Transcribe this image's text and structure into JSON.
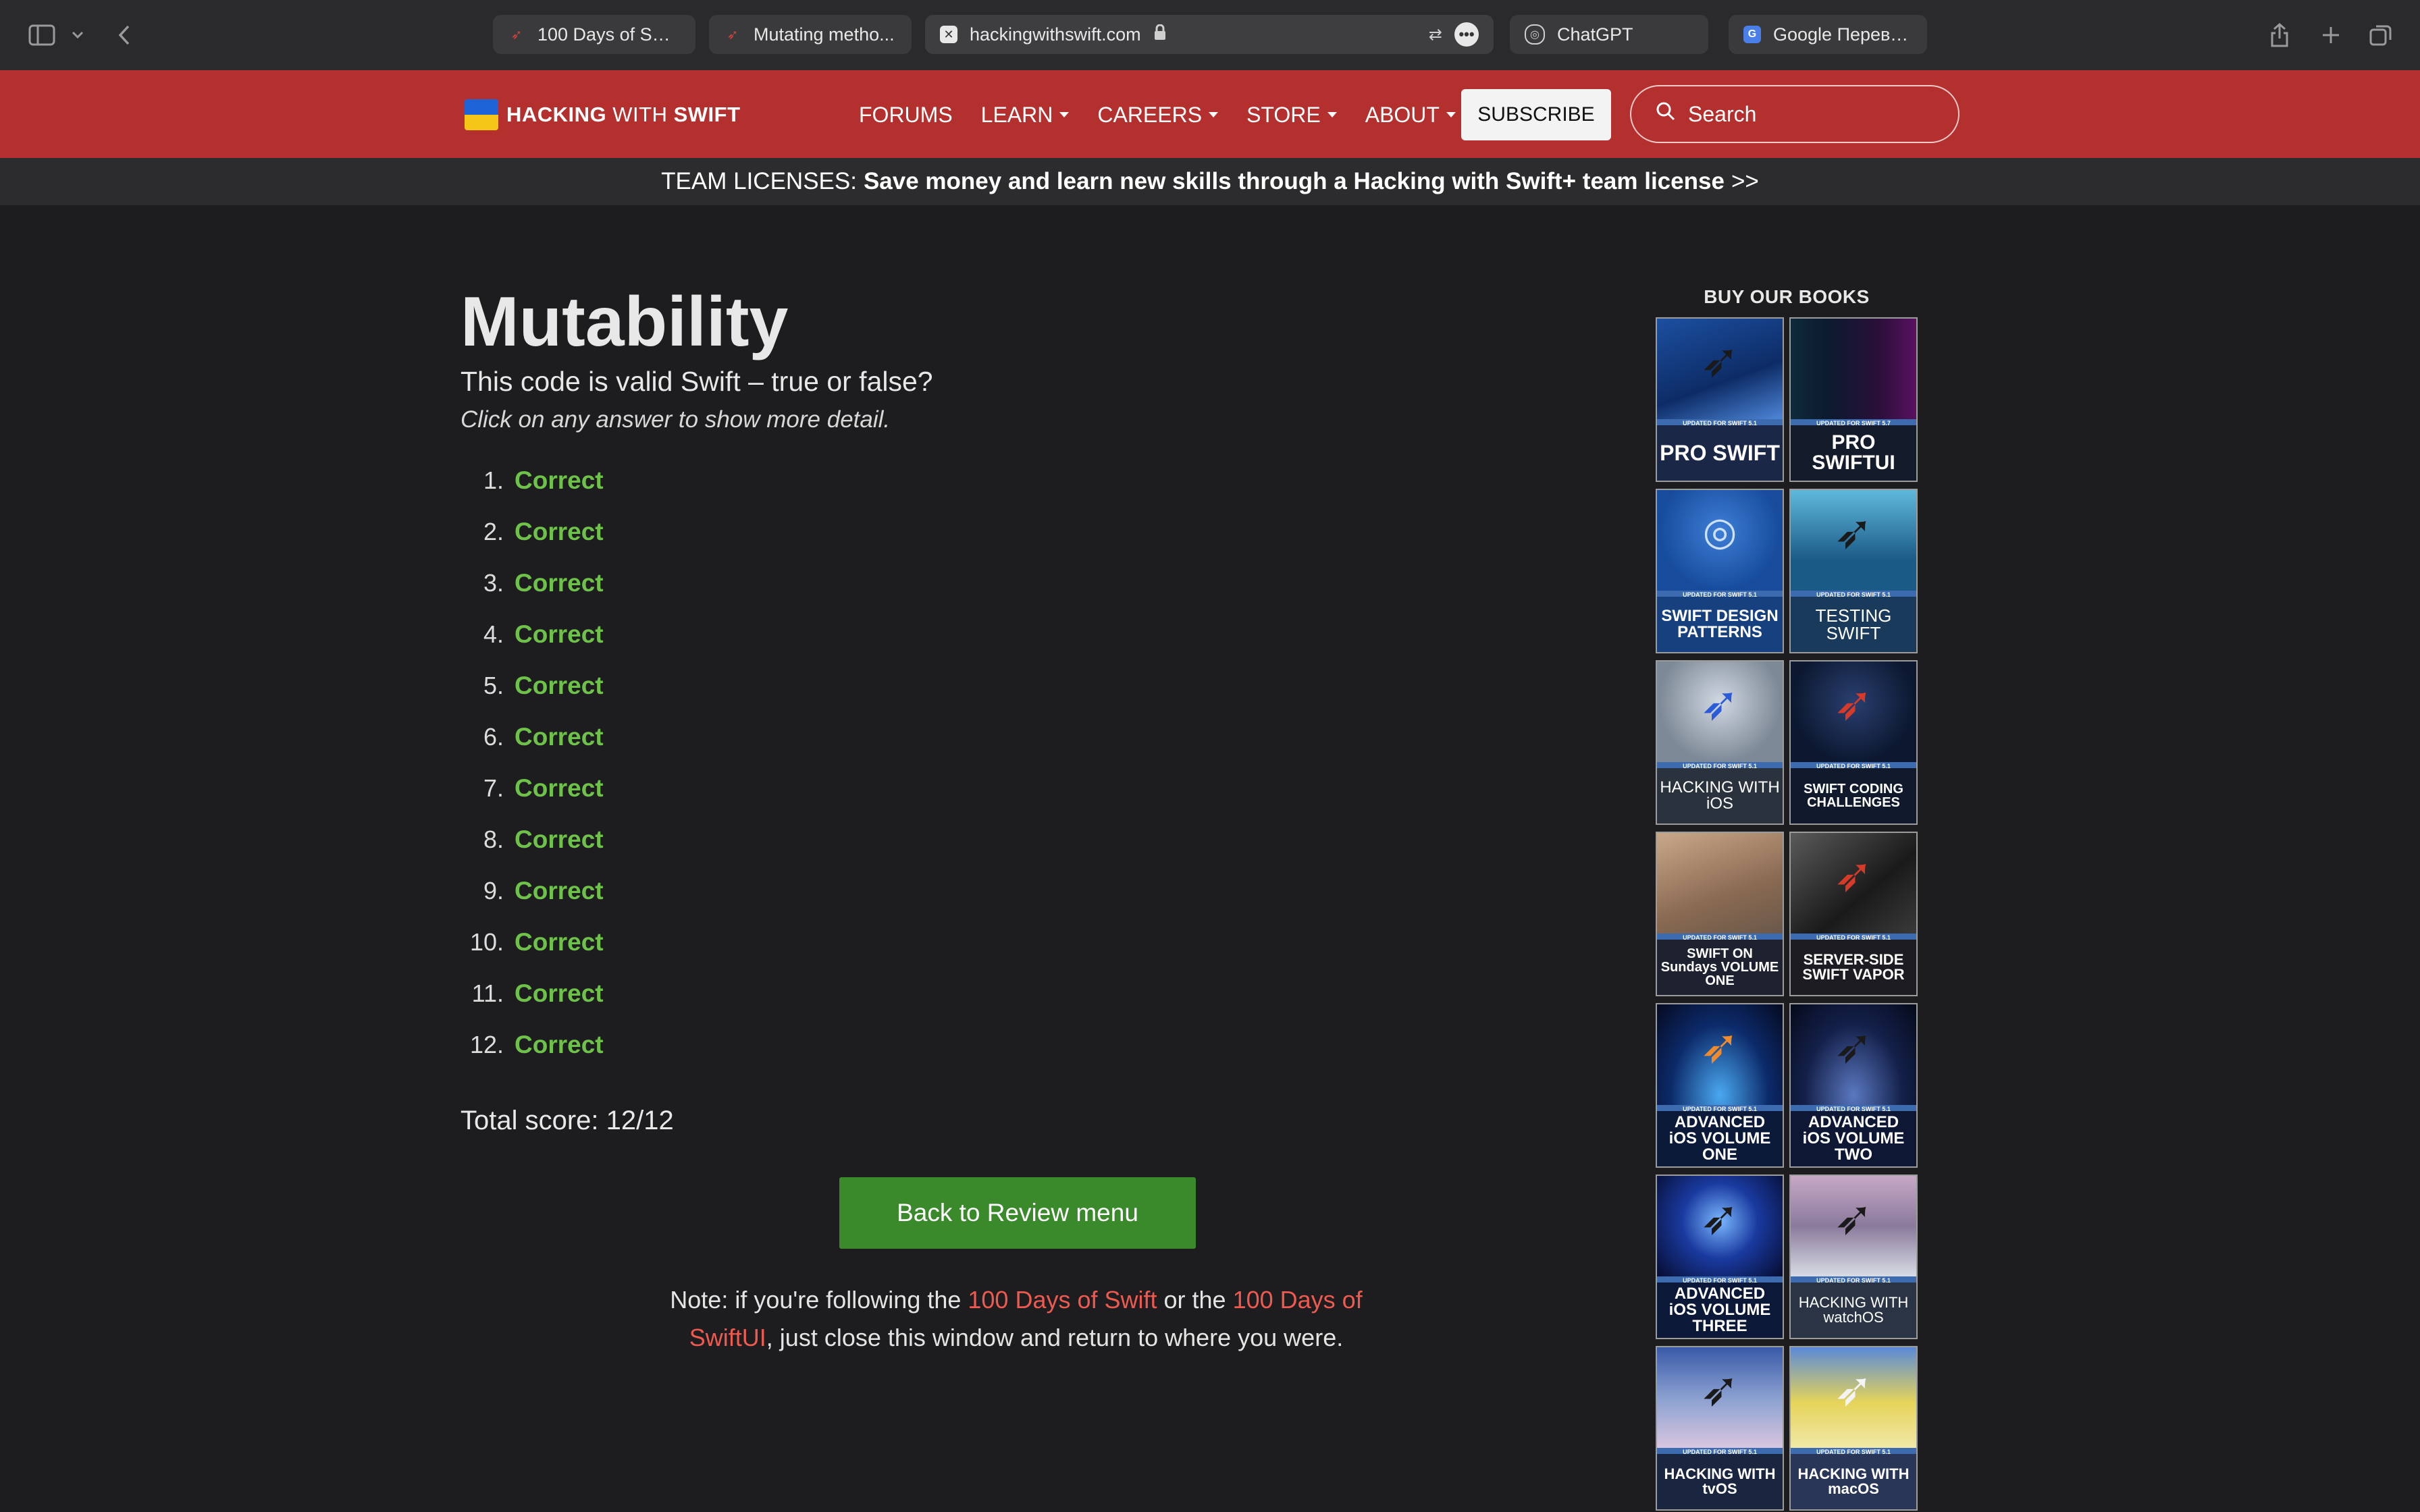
{
  "browser": {
    "tabs": [
      {
        "label": "100 Days of Swi...",
        "icon": "swift-bird-icon"
      },
      {
        "label": "Mutating metho...",
        "icon": "swift-bird-icon"
      },
      {
        "label": "hackingwithswift.com",
        "icon": "close-icon",
        "active": true
      },
      {
        "label": "ChatGPT",
        "icon": "chatgpt-icon"
      },
      {
        "label": "Google Перево...",
        "icon": "google-translate-icon"
      }
    ]
  },
  "header": {
    "logo_part1": "HACKING",
    "logo_part2": " WITH ",
    "logo_part3": "SWIFT",
    "nav": [
      {
        "label": "FORUMS",
        "dropdown": false
      },
      {
        "label": "LEARN",
        "dropdown": true
      },
      {
        "label": "CAREERS",
        "dropdown": true
      },
      {
        "label": "STORE",
        "dropdown": true
      },
      {
        "label": "ABOUT",
        "dropdown": true
      }
    ],
    "subscribe": "SUBSCRIBE",
    "search_placeholder": "Search"
  },
  "banner": {
    "prefix": "TEAM LICENSES:",
    "text": "Save money and learn new skills through a Hacking with Swift+ team license",
    "arrow": ">>"
  },
  "main": {
    "title": "Mutability",
    "question": "This code is valid Swift – true or false?",
    "hint": "Click on any answer to show more detail.",
    "answers": [
      {
        "num": "1.",
        "result": "Correct"
      },
      {
        "num": "2.",
        "result": "Correct"
      },
      {
        "num": "3.",
        "result": "Correct"
      },
      {
        "num": "4.",
        "result": "Correct"
      },
      {
        "num": "5.",
        "result": "Correct"
      },
      {
        "num": "6.",
        "result": "Correct"
      },
      {
        "num": "7.",
        "result": "Correct"
      },
      {
        "num": "8.",
        "result": "Correct"
      },
      {
        "num": "9.",
        "result": "Correct"
      },
      {
        "num": "10.",
        "result": "Correct"
      },
      {
        "num": "11.",
        "result": "Correct"
      },
      {
        "num": "12.",
        "result": "Correct"
      }
    ],
    "score": "Total score: 12/12",
    "back_button": "Back to Review menu",
    "note_before": "Note: if you're following the ",
    "note_link1": "100 Days of Swift",
    "note_middle": " or the ",
    "note_link2": "100 Days of SwiftUI",
    "note_after": ", just close this window and return to where you were."
  },
  "sidebar": {
    "title": "BUY OUR BOOKS",
    "books": [
      {
        "name": "PRO SWIFT",
        "updated": "UPDATED FOR SWIFT 5.1"
      },
      {
        "name": "PRO SWIFTUI",
        "updated": "UPDATED FOR SWIFT 5.7"
      },
      {
        "name": "SWIFT DESIGN PATTERNS",
        "updated": "UPDATED FOR SWIFT 5.1"
      },
      {
        "name": "TESTING SWIFT",
        "updated": "UPDATED FOR SWIFT 5.1"
      },
      {
        "name": "HACKING WITH iOS",
        "updated": "UPDATED FOR SWIFT 5.1"
      },
      {
        "name": "SWIFT CODING CHALLENGES",
        "updated": "UPDATED FOR SWIFT 5.1"
      },
      {
        "name": "SWIFT ON Sundays VOLUME ONE",
        "updated": "UPDATED FOR SWIFT 5.1"
      },
      {
        "name": "SERVER-SIDE SWIFT VAPOR",
        "updated": "UPDATED FOR SWIFT 5.1"
      },
      {
        "name": "ADVANCED iOS VOLUME ONE",
        "updated": "UPDATED FOR SWIFT 5.1"
      },
      {
        "name": "ADVANCED iOS VOLUME TWO",
        "updated": "UPDATED FOR SWIFT 5.1"
      },
      {
        "name": "ADVANCED iOS VOLUME THREE",
        "updated": "UPDATED FOR SWIFT 5.1"
      },
      {
        "name": "HACKING WITH watchOS",
        "updated": "UPDATED FOR SWIFT 5.1"
      },
      {
        "name": "HACKING WITH tvOS",
        "updated": "UPDATED FOR SWIFT 5.1"
      },
      {
        "name": "HACKING WITH macOS",
        "updated": "UPDATED FOR SWIFT 5.1"
      }
    ]
  },
  "colors": {
    "header_red": "#b3302e",
    "correct_green": "#6ec24a",
    "button_green": "#3a8a2c",
    "link_red": "#ee5a4f",
    "background": "#1d1d1f"
  }
}
